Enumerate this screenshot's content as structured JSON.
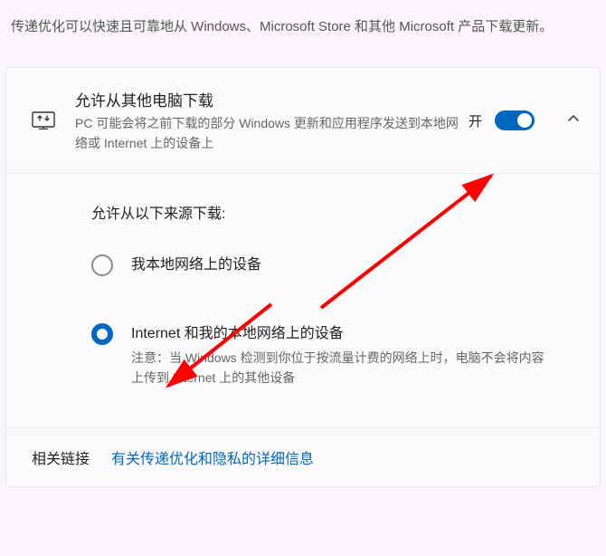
{
  "description": "传递优化可以快速且可靠地从 Windows、Microsoft Store 和其他 Microsoft 产品下载更新。",
  "allowFromOther": {
    "title": "允许从其他电脑下载",
    "subtitle": "PC 可能会将之前下载的部分 Windows 更新和应用程序发送到本地网络或 Internet 上的设备上",
    "toggleLabel": "开",
    "toggleOn": true
  },
  "sources": {
    "title": "允许从以下来源下载:",
    "options": [
      {
        "title": "我本地网络上的设备",
        "note": "",
        "selected": false
      },
      {
        "title": "Internet 和我的本地网络上的设备",
        "note": "注意：当 Windows 检测到你位于按流量计费的网络上时，电脑不会将内容上传到 Internet 上的其他设备",
        "selected": true
      }
    ]
  },
  "related": {
    "label": "相关链接",
    "linkText": "有关传递优化和隐私的详细信息"
  }
}
